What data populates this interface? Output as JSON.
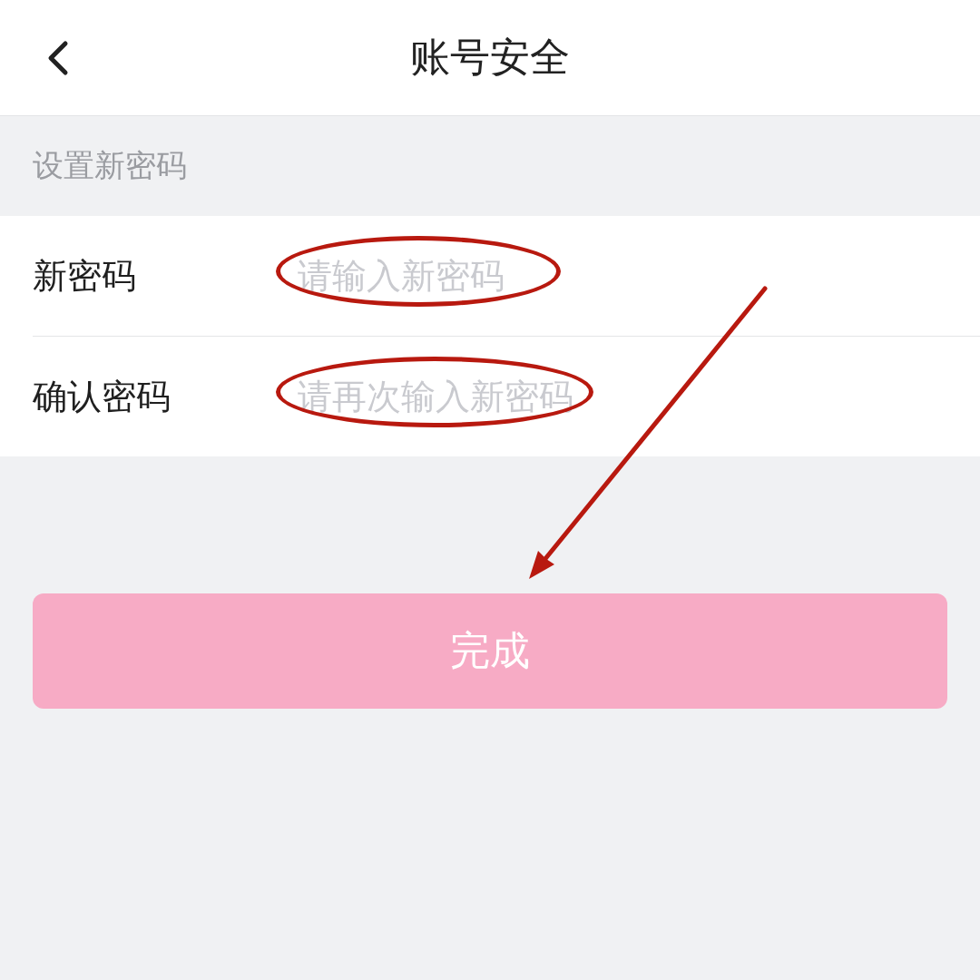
{
  "header": {
    "title": "账号安全"
  },
  "section_title": "设置新密码",
  "fields": [
    {
      "label": "新密码",
      "placeholder": "请输入新密码",
      "circled": true
    },
    {
      "label": "确认密码",
      "placeholder": "请再次输入新密码",
      "circled": true
    }
  ],
  "submit_button": {
    "label": "完成",
    "disabled": true
  },
  "annotation_arrow": true
}
